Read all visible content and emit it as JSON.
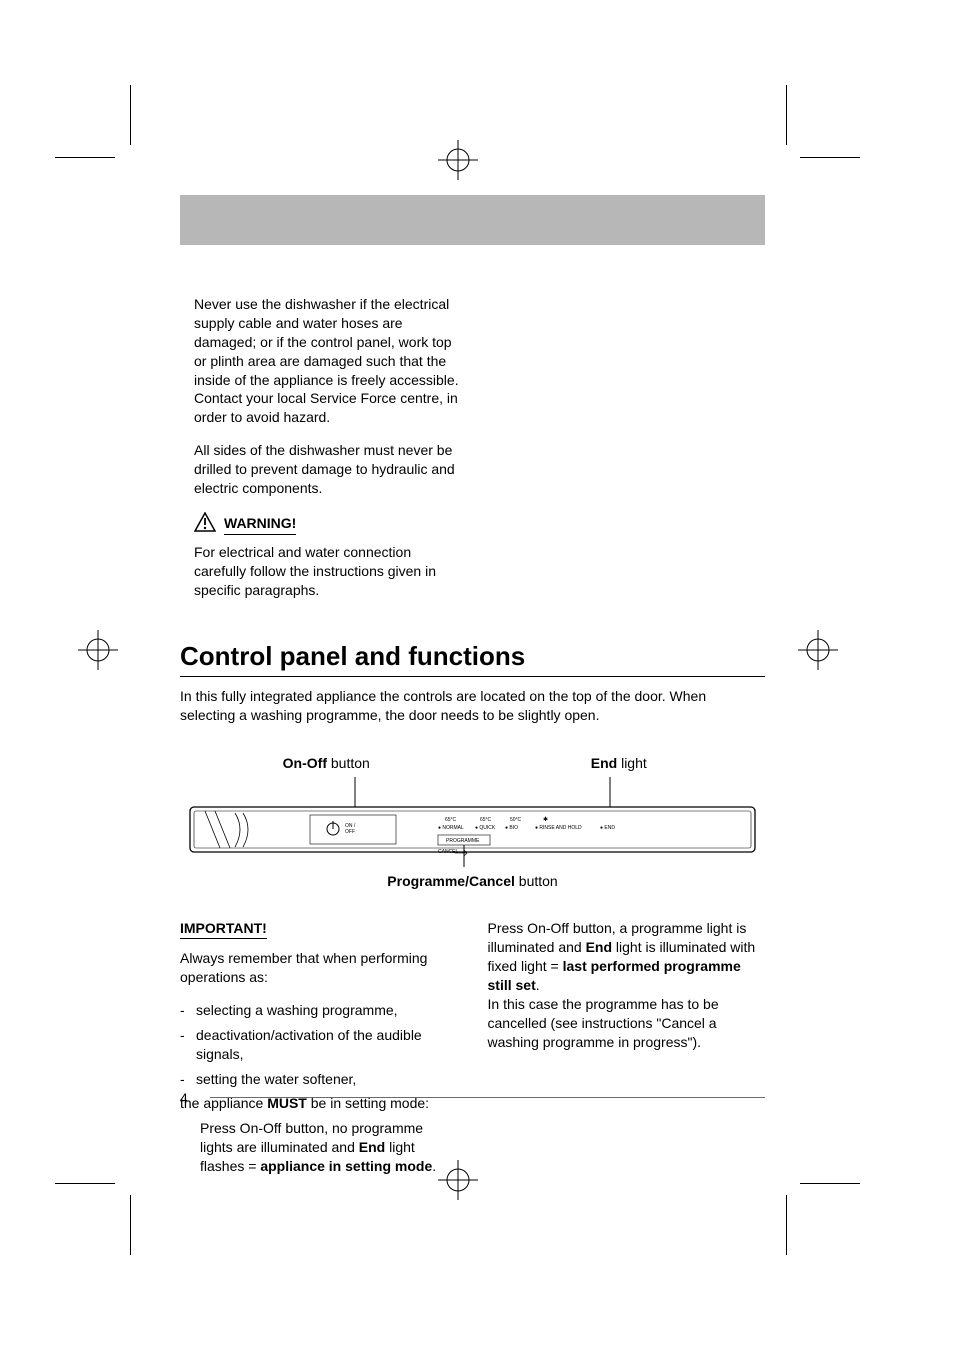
{
  "safety": {
    "electrical_para": "Never use the dishwasher if the electrical supply cable and water hoses are damaged; or if the control panel, work top or plinth area are damaged such that the inside of the appliance is freely accessible. Contact your local Service Force centre, in order to avoid hazard.",
    "drill_para": "All sides of the dishwasher must never be drilled to prevent damage to hydraulic and electric components.",
    "warning_label": "WARNING!",
    "warning_para": "For electrical and water connection carefully follow the instructions given in specific paragraphs."
  },
  "section": {
    "title": "Control panel and functions",
    "intro": "In this fully integrated appliance the controls are located on the top of the door. When selecting a washing programme, the door needs to be slightly open."
  },
  "diagram": {
    "onoff_bold": "On-Off",
    "onoff_rest": " button",
    "end_bold": "End",
    "end_rest": " light",
    "prog_bold": "Programme/Cancel",
    "prog_rest": " button",
    "panel": {
      "onoff_symbol": "⏻",
      "onoff_text1": "ON /",
      "onoff_text2": "OFF",
      "normal_temp": "65°C",
      "normal_label": "● NORMAL",
      "quick_temp": "65°C",
      "quick_label": "● QUICK",
      "bio_temp": "50°C",
      "bio_label": "● BIO",
      "rinse_symbol": "✱",
      "rinse_label": "● RINSE AND HOLD",
      "end_label": "● END",
      "programme_box": "PROGRAMME",
      "cancel_label": "CANCEL"
    }
  },
  "important": {
    "label": "IMPORTANT!",
    "always_remember": "Always remember that when performing operations as:",
    "bullets": [
      "selecting a washing programme,",
      "deactivation/activation of the audible signals,",
      "setting the water softener,"
    ],
    "must_pre": "the appliance ",
    "must_bold": "MUST",
    "must_post": " be in setting mode:",
    "block1_pre": "Press On-Off button, no programme lights are illuminated and ",
    "block1_end": "End",
    "block1_mid": " light flashes = ",
    "block1_bold": "appliance in setting mode",
    "block1_post": ".",
    "col2_p_pre": "Press On-Off button, a programme light is illuminated and ",
    "col2_p_end": "End",
    "col2_p_mid": " light is illuminated with fixed light = ",
    "col2_p_bold": "last performed programme still set",
    "col2_p_post": ".",
    "col2_p2": "In this case the programme has to be cancelled (see instructions \"Cancel a washing programme in progress\")."
  },
  "page_number": "4"
}
